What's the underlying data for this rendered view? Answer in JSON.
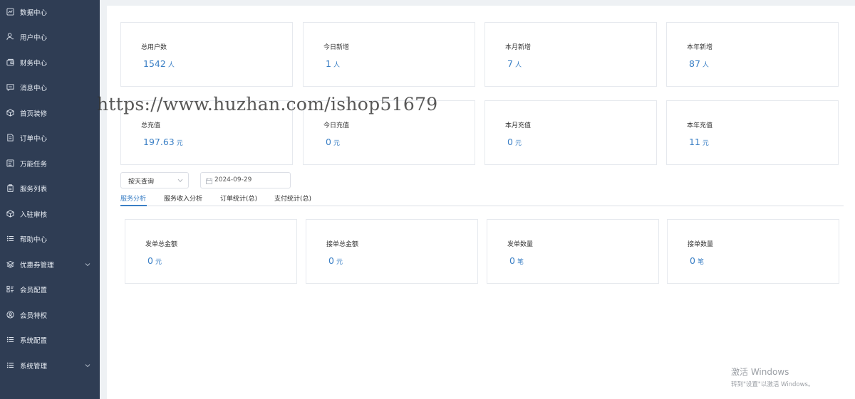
{
  "sidebar": {
    "items": [
      {
        "label": "数据中心",
        "icon": "chart-icon",
        "has_submenu": false
      },
      {
        "label": "用户中心",
        "icon": "user-icon",
        "has_submenu": false
      },
      {
        "label": "财务中心",
        "icon": "wallet-icon",
        "has_submenu": false
      },
      {
        "label": "消息中心",
        "icon": "message-icon",
        "has_submenu": false
      },
      {
        "label": "首页装修",
        "icon": "box-icon",
        "has_submenu": false
      },
      {
        "label": "订单中心",
        "icon": "document-icon",
        "has_submenu": false
      },
      {
        "label": "万能任务",
        "icon": "task-icon",
        "has_submenu": false
      },
      {
        "label": "服务列表",
        "icon": "clipboard-icon",
        "has_submenu": false
      },
      {
        "label": "入驻审核",
        "icon": "cube-icon",
        "has_submenu": false
      },
      {
        "label": "帮助中心",
        "icon": "list-icon",
        "has_submenu": false
      },
      {
        "label": "优惠券管理",
        "icon": "layers-icon",
        "has_submenu": true
      },
      {
        "label": "会员配置",
        "icon": "grid-list-icon",
        "has_submenu": false
      },
      {
        "label": "会员特权",
        "icon": "user-circle-icon",
        "has_submenu": false
      },
      {
        "label": "系统配置",
        "icon": "list-icon",
        "has_submenu": false
      },
      {
        "label": "系统管理",
        "icon": "list-icon",
        "has_submenu": true
      }
    ]
  },
  "stats_users": [
    {
      "title": "总用户数",
      "value": "1542",
      "unit": "人"
    },
    {
      "title": "今日新增",
      "value": "1",
      "unit": "人"
    },
    {
      "title": "本月新增",
      "value": "7",
      "unit": "人"
    },
    {
      "title": "本年新增",
      "value": "87",
      "unit": "人"
    }
  ],
  "stats_recharge": [
    {
      "title": "总充值",
      "value": "197.63",
      "unit": "元"
    },
    {
      "title": "今日充值",
      "value": "0",
      "unit": "元"
    },
    {
      "title": "本月充值",
      "value": "0",
      "unit": "元"
    },
    {
      "title": "本年充值",
      "value": "11",
      "unit": "元"
    }
  ],
  "filters": {
    "query_mode": "按天查询",
    "date": "2024-09-29"
  },
  "tabs": [
    {
      "label": "服务分析",
      "active": true
    },
    {
      "label": "服务收入分析",
      "active": false
    },
    {
      "label": "订单统计(总)",
      "active": false
    },
    {
      "label": "支付统计(总)",
      "active": false
    }
  ],
  "stats_service": [
    {
      "title": "发单总金额",
      "value": "0",
      "unit": "元"
    },
    {
      "title": "接单总金额",
      "value": "0",
      "unit": "元"
    },
    {
      "title": "发单数量",
      "value": "0",
      "unit": "笔"
    },
    {
      "title": "接单数量",
      "value": "0",
      "unit": "笔"
    }
  ],
  "watermark_text": "https://www.huzhan.com/ishop51679",
  "windows_activation": {
    "line1": "激活 Windows",
    "line2": "转到\"设置\"以激活 Windows。"
  },
  "colors": {
    "sidebar_bg": "#2f3d54",
    "accent": "#3a7fc5",
    "page_bg": "#eef1f4"
  }
}
